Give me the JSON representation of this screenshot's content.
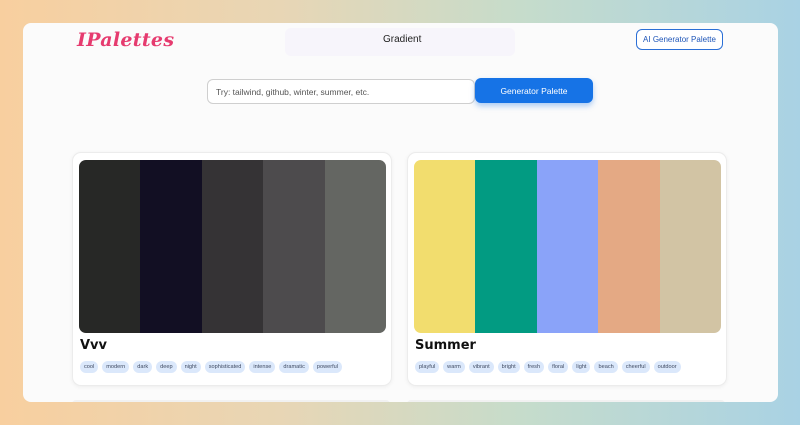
{
  "header": {
    "logo": "IPalettes",
    "nav_gradient": "Gradient",
    "ai_button": "AI Generator Palette"
  },
  "search": {
    "placeholder": "Try: tailwind, github, winter, summer, etc.",
    "button": "Generator Palette"
  },
  "palettes": [
    {
      "title": "Vvv",
      "colors": [
        "#272826",
        "#120f23",
        "#353335",
        "#4d4b4d",
        "#646662"
      ],
      "tags": [
        "cool",
        "modern",
        "dark",
        "deep",
        "night",
        "sophisticated",
        "intense",
        "dramatic",
        "powerful"
      ]
    },
    {
      "title": "Summer",
      "colors": [
        "#f2dd6e",
        "#029b82",
        "#8aa3f9",
        "#e4a984",
        "#d2c4a4"
      ],
      "tags": [
        "playful",
        "warm",
        "vibrant",
        "bright",
        "fresh",
        "floral",
        "light",
        "beach",
        "cheerful",
        "outdoor"
      ]
    }
  ]
}
